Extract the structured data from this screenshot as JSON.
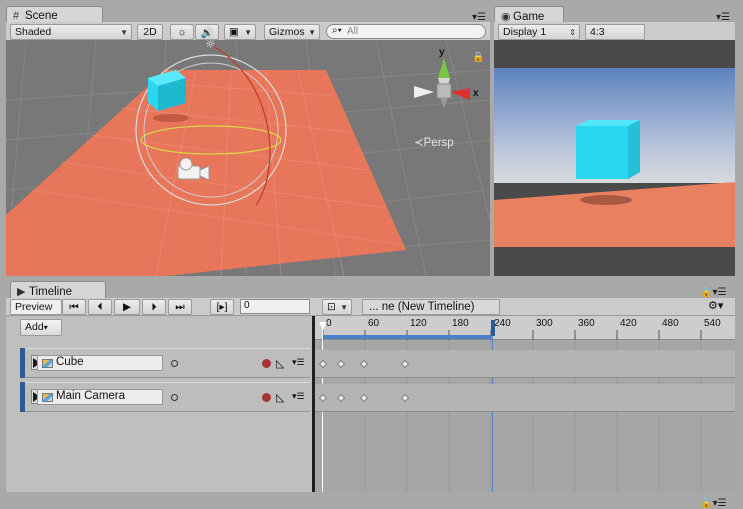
{
  "scene_tab": {
    "icon": "grid-icon",
    "label": "Scene"
  },
  "game_tab": {
    "icon": "game-controller-icon",
    "label": "Game"
  },
  "scene_toolbar": {
    "shading_mode": "Shaded",
    "mode_2d": "2D",
    "gizmos_label": "Gizmos",
    "search_placeholder": "All"
  },
  "gizmo": {
    "y_label": "y",
    "x_label": "x",
    "persp_label": "Persp"
  },
  "game_toolbar": {
    "display": "Display 1",
    "aspect": "4:3"
  },
  "timeline_tab": {
    "label": "Timeline"
  },
  "timeline_toolbar": {
    "preview_label": "Preview",
    "frame_value": "0",
    "timeline_name": "... ne (New Timeline)",
    "add_label": "Add"
  },
  "ruler": {
    "ticks": [
      "0",
      "60",
      "120",
      "180",
      "240",
      "300",
      "360",
      "420",
      "480",
      "540"
    ]
  },
  "tracks": [
    {
      "name": "Cube",
      "keyframes": [
        0,
        30,
        70,
        140
      ]
    },
    {
      "name": "Main Camera",
      "keyframes": [
        0,
        30,
        70,
        140
      ]
    }
  ],
  "colors": {
    "accent": "#2d5c94",
    "plane": "#e8765a",
    "cube": "#29d8f0",
    "record": "#a83333"
  }
}
